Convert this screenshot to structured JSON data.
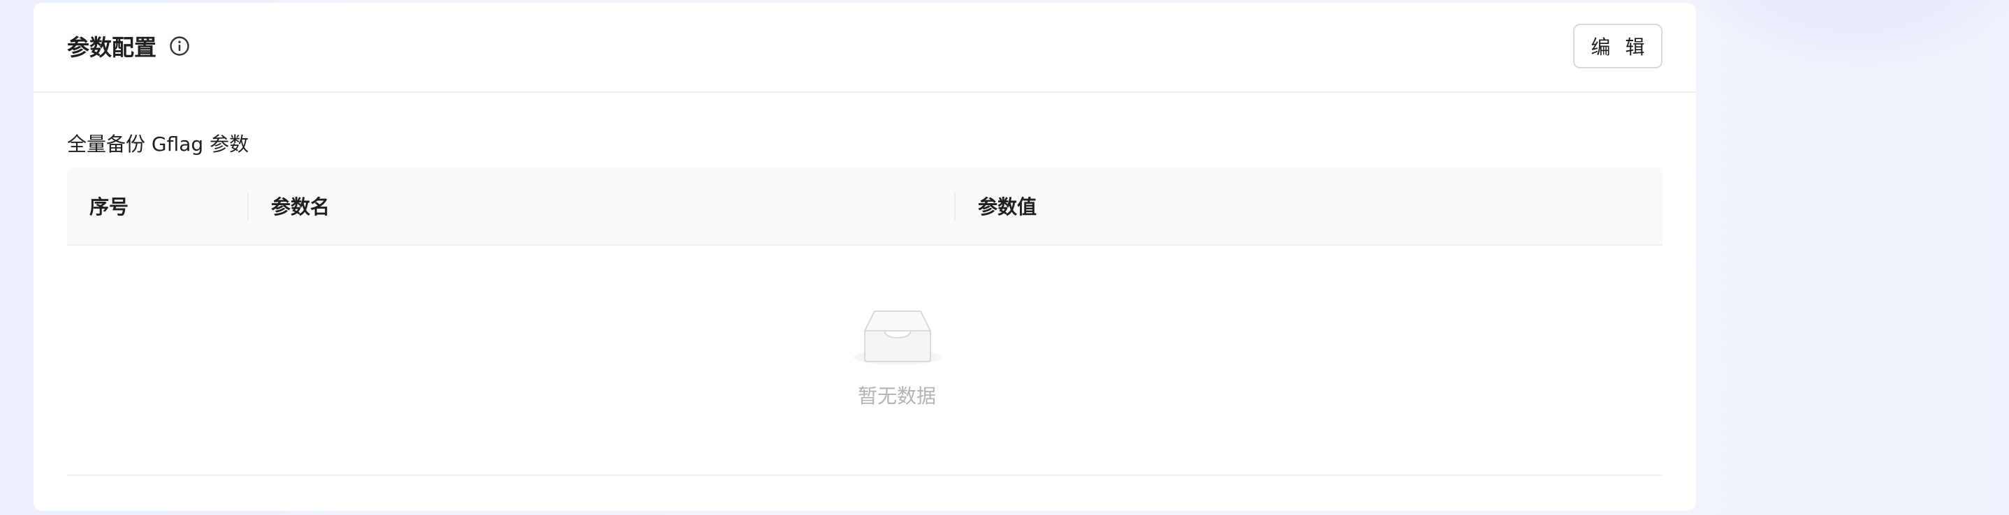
{
  "card": {
    "title": "参数配置",
    "edit_label": "编 辑"
  },
  "section": {
    "label": "全量备份 Gflag 参数"
  },
  "table": {
    "columns": [
      "序号",
      "参数名",
      "参数值"
    ],
    "rows": [],
    "empty_text": "暂无数据"
  },
  "icons": {
    "info": "info-circle-icon",
    "empty": "empty-inbox-icon"
  },
  "colors": {
    "background": "#eef0fd",
    "card": "#ffffff",
    "header_bg": "#fafafa",
    "muted_text": "#b3b3b3"
  }
}
